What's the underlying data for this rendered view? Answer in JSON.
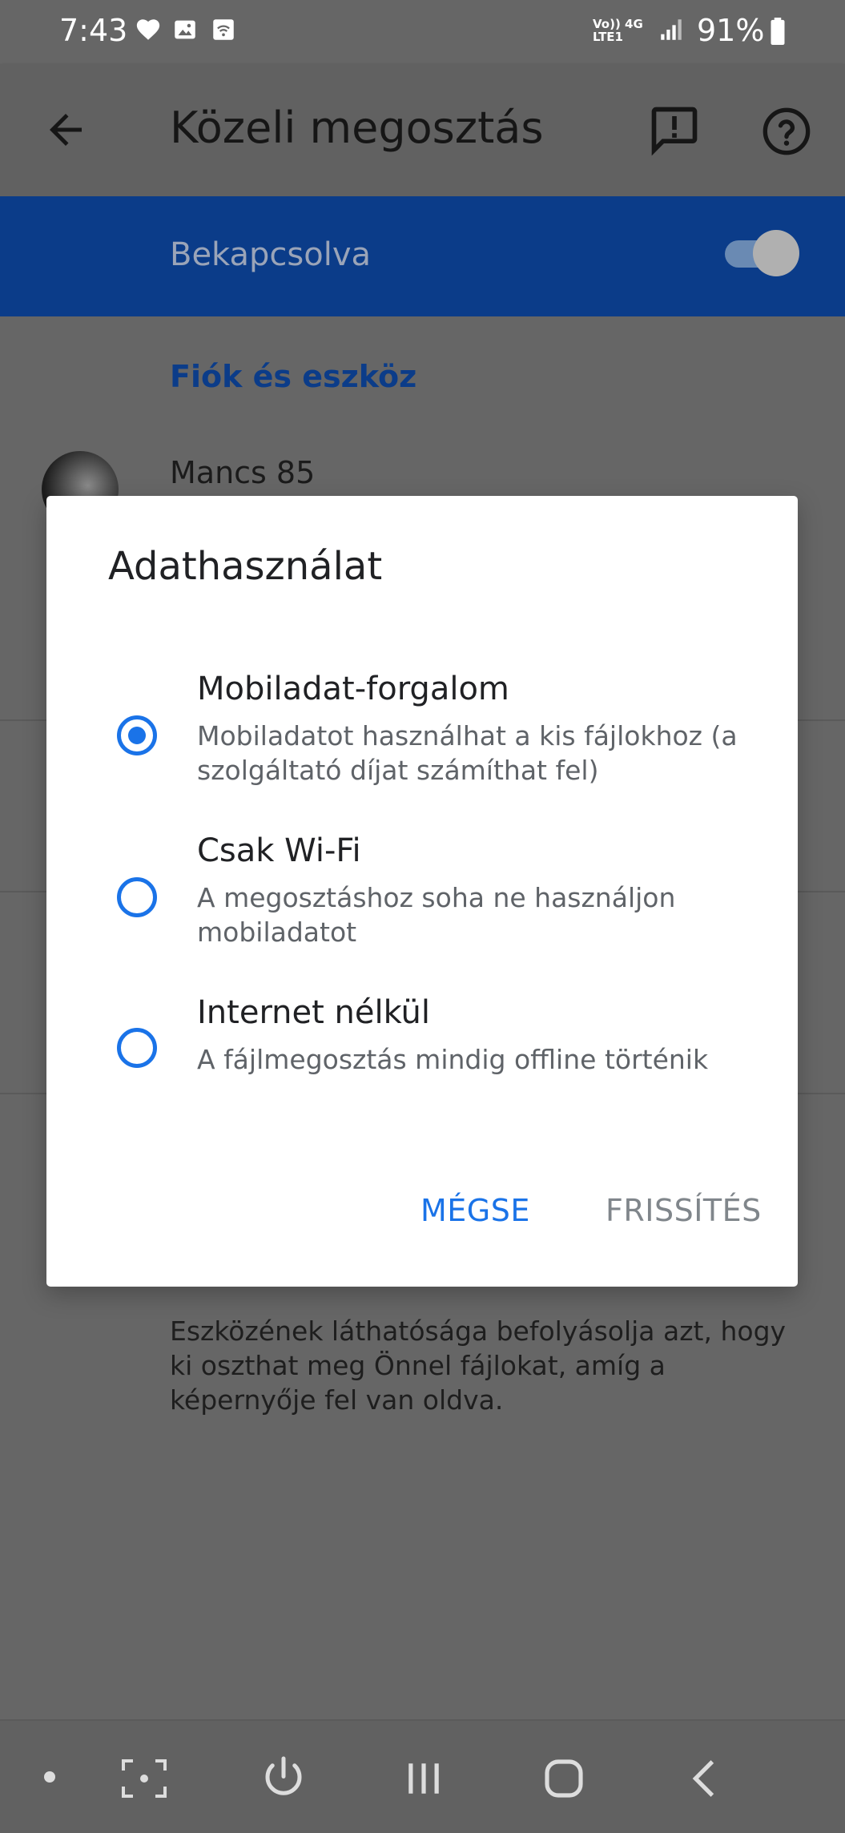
{
  "status_bar": {
    "time": "7:43",
    "battery_percent": "91%",
    "network_line1": "Vo)) 4G",
    "network_line2": "LTE1"
  },
  "app_bar": {
    "title": "Közeli megosztás",
    "back_icon": "arrow-back-icon",
    "feedback_icon": "feedback-icon",
    "help_icon": "help-icon"
  },
  "toggle": {
    "label": "Bekapcsolva",
    "enabled": true
  },
  "account_section": {
    "heading": "Fiók és eszköz",
    "account_name": "Mancs 85"
  },
  "visibility": {
    "description": "Eszközének láthatósága befolyásolja azt, hogy ki oszthat meg Önnel fájlokat, amíg a képernyője fel van oldva."
  },
  "dialog": {
    "title": "Adathasználat",
    "options": [
      {
        "label": "Mobiladat-forgalom",
        "description": "Mobiladatot használhat a kis fájlokhoz (a szolgáltató díjat számíthat fel)",
        "selected": true
      },
      {
        "label": "Csak Wi-Fi",
        "description": "A megosztáshoz soha ne használjon mobiladatot",
        "selected": false
      },
      {
        "label": "Internet nélkül",
        "description": "A fájlmegosztás mindig offline történik",
        "selected": false
      }
    ],
    "cancel_label": "MÉGSE",
    "update_label": "FRISSÍTÉS"
  },
  "colors": {
    "accent": "#1a73e8",
    "toggle_bar": "#0b3c89",
    "scrim_background": "#666666"
  }
}
